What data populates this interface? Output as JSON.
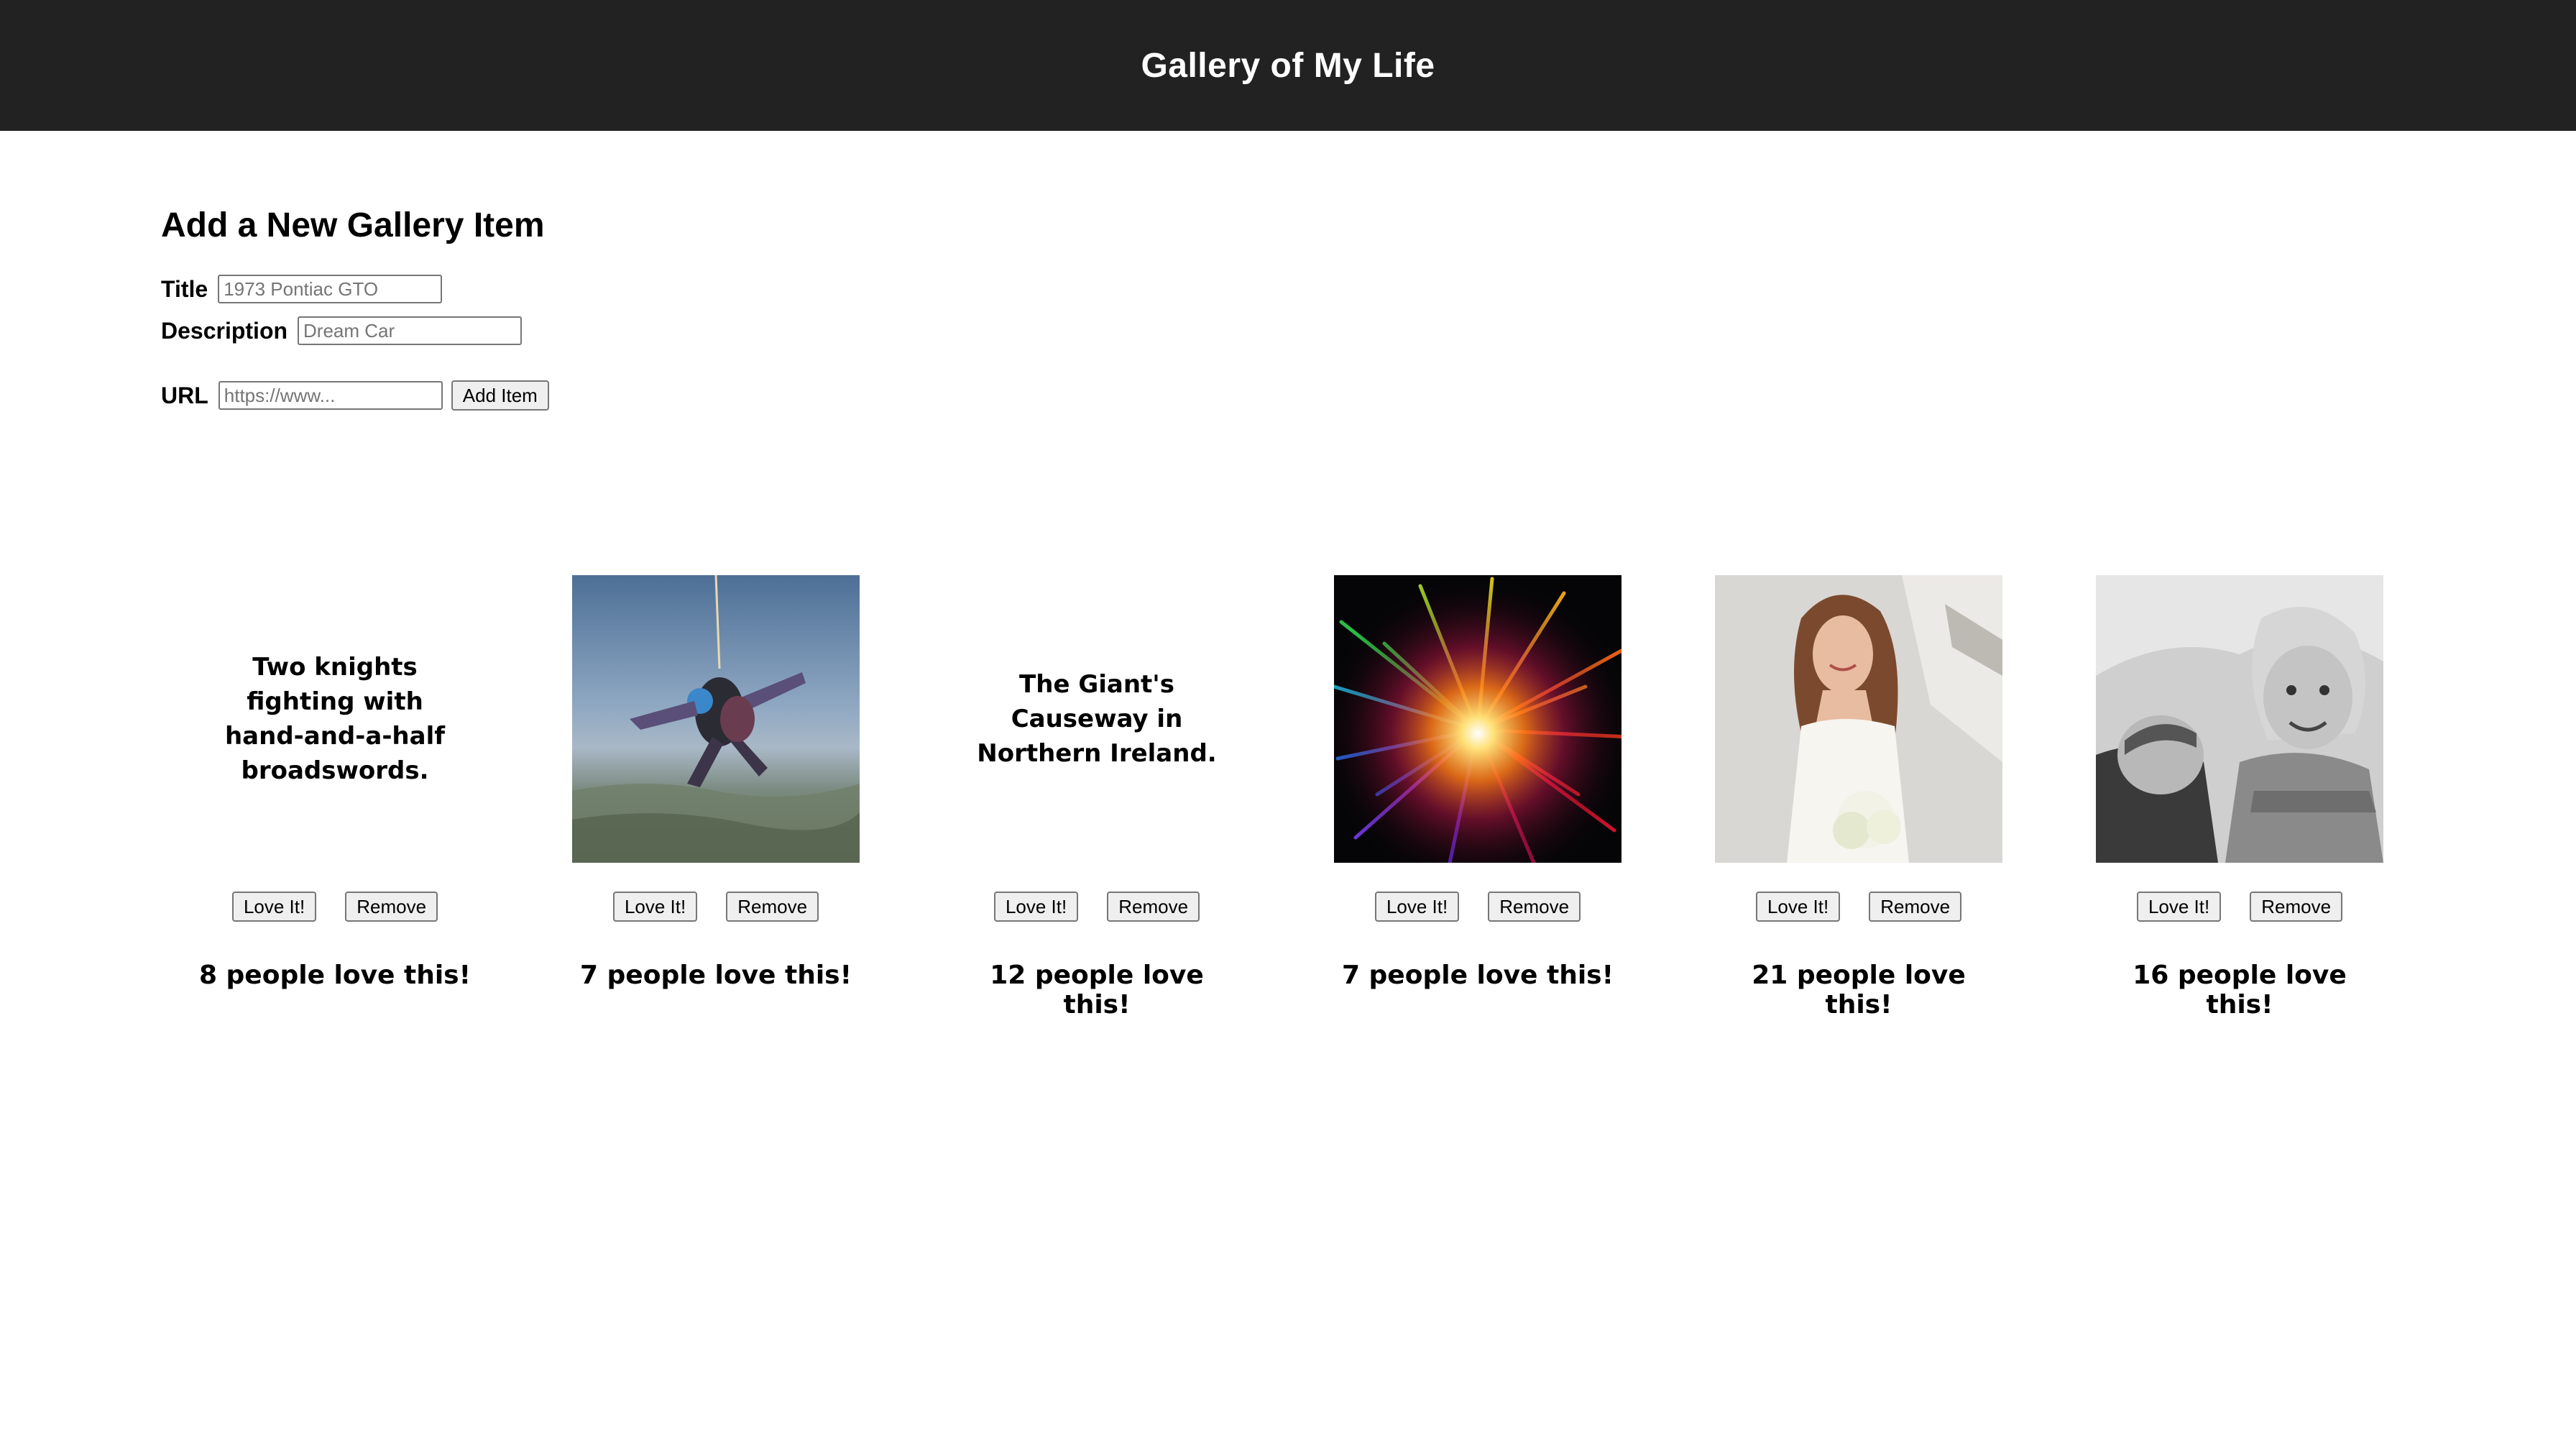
{
  "header": {
    "title": "Gallery of My Life"
  },
  "form": {
    "heading": "Add a New Gallery Item",
    "title_label": "Title",
    "title_placeholder": "1973 Pontiac GTO",
    "description_label": "Description",
    "description_placeholder": "Dream Car",
    "url_label": "URL",
    "url_placeholder": "https://www...",
    "add_button": "Add Item"
  },
  "gallery": {
    "love_button": "Love It!",
    "remove_button": "Remove",
    "items": [
      {
        "caption": "Two knights fighting with hand-and-a-half broadswords.",
        "loves": "8 people love this!",
        "image": "none"
      },
      {
        "caption": "",
        "loves": "7 people love this!",
        "image": "skydivers-photo"
      },
      {
        "caption": "The Giant's Causeway in Northern Ireland.",
        "loves": "12 people love this!",
        "image": "none"
      },
      {
        "caption": "",
        "loves": "7 people love this!",
        "image": "rainbow-burst-photo"
      },
      {
        "caption": "",
        "loves": "21 people love this!",
        "image": "bride-photo"
      },
      {
        "caption": "",
        "loves": "16 people love this!",
        "image": "children-bw-photo"
      }
    ]
  }
}
